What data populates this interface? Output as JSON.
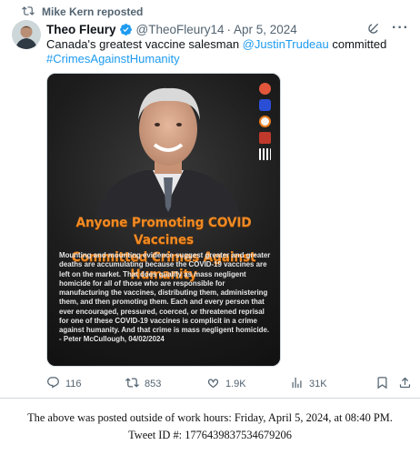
{
  "repost": {
    "text": "Mike Kern reposted",
    "icon": "repost-icon"
  },
  "tweet": {
    "author_name": "Theo Fleury",
    "handle": "@TheoFleury14",
    "separator": "·",
    "date": "Apr 5, 2024",
    "text_plain_1": "Canada's greatest vaccine salesman ",
    "mention": "@JustinTrudeau",
    "text_plain_2": " committed",
    "hashtag": "#CrimesAgainstHumanity",
    "more_label": "···",
    "link_color": "#1d9bf0"
  },
  "media": {
    "headline_line1": "Anyone Promoting COVID Vaccines",
    "headline_line2": "Committed Crimes Against Humanity",
    "body": "Mounting and mounting evidence suggest greater and greater deaths are accumulating because the COVID-19 vaccines are left on the market. That does qualify as mass negligent homicide for all of those who are responsible for manufacturing the vaccines, distributing them, administering them, and then promoting them. Each and every person that ever encouraged, pressured, coerced, or threatened reprisal for one of these COVID-19 vaccines is complicit in a crime against humanity. And that crime is mass negligent homicide. - Peter McCullough, 04/02/2024",
    "headline_color": "#f08a24"
  },
  "actions": {
    "replies": "116",
    "reposts": "853",
    "likes": "1.9K",
    "views": "31K"
  },
  "footer": {
    "line1": "The above was posted outside of work hours: Friday, April 5, 2024, at 08:40 PM.",
    "line2": "Tweet ID #: 1776439837534679206"
  }
}
